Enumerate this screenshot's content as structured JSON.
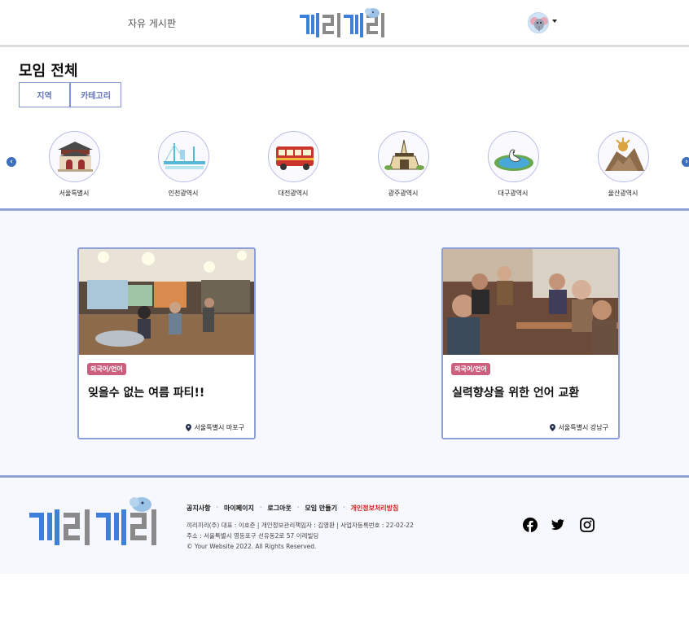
{
  "header": {
    "board_link": "자유 게시판",
    "logo_text": "끼리끼리",
    "profile_alt": "profile-avatar"
  },
  "page": {
    "title": "모임 전체",
    "filters": [
      "지역",
      "카테고리"
    ]
  },
  "regions": [
    {
      "label": "서울특별시",
      "icon": "palace-gate-icon"
    },
    {
      "label": "인천광역시",
      "icon": "bridge-icon"
    },
    {
      "label": "대전광역시",
      "icon": "bus-icon"
    },
    {
      "label": "광주광역시",
      "icon": "monument-icon"
    },
    {
      "label": "대구광역시",
      "icon": "lake-bird-icon"
    },
    {
      "label": "울산광역시",
      "icon": "whale-rock-icon"
    }
  ],
  "cards": [
    {
      "tag": "외국어/언어",
      "title": "잊을수 없는 여름 파티!!",
      "location": "서울특별시 마포구"
    },
    {
      "tag": "외국어/언어",
      "title": "실력향상을 위한 언어 교환",
      "location": "서울특별시 강남구"
    }
  ],
  "footer": {
    "links": [
      "공지사항",
      "마이페이지",
      "로그아웃",
      "모임 만들기",
      "개인정보처리방침"
    ],
    "info_line1": "끼리끼리(주) 대표 : 이호준 | 개인정보관리책임자 : 김영환 | 사업자등록번호 : 22-02-22",
    "info_line2": "주소 : 서울특별시 영등포구 선유동2로 57 이레빌딩",
    "copyright": "© Your Website 2022. All Rights Reserved."
  },
  "colors": {
    "accent": "#8ea0d8",
    "logo_blue": "#3e7fd9",
    "logo_gray": "#8a8a8a",
    "tag": "#cc5f7d",
    "privacy_link": "#d21f1f"
  }
}
